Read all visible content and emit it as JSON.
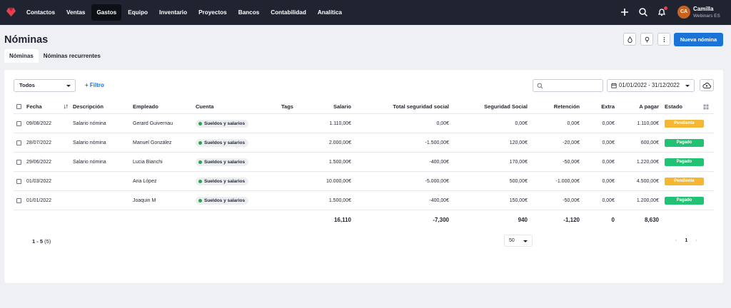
{
  "nav": {
    "items": [
      "Contactos",
      "Ventas",
      "Gastos",
      "Equipo",
      "Inventario",
      "Proyectos",
      "Bancos",
      "Contabilidad",
      "Analítica"
    ],
    "active": "Gastos"
  },
  "user": {
    "initials": "CA",
    "name": "Camilla",
    "org": "Webinars ES"
  },
  "page": {
    "title": "Nóminas",
    "new_button": "Nueva nómina"
  },
  "tabs": [
    {
      "label": "Nóminas",
      "active": true
    },
    {
      "label": "Nóminas recurrentes",
      "active": false
    }
  ],
  "toolbar": {
    "select_value": "Todos",
    "filter_label": "+ Filtro",
    "date_range": "01/01/2022 - 31/12/2022"
  },
  "table": {
    "headers": {
      "fecha": "Fecha",
      "descripcion": "Descripción",
      "empleado": "Empleado",
      "cuenta": "Cuenta",
      "tags": "Tags",
      "salario": "Salario",
      "total_ss": "Total seguridad social",
      "ss": "Seguridad Social",
      "retencion": "Retención",
      "extra": "Extra",
      "a_pagar": "A pagar",
      "estado": "Estado"
    },
    "rows": [
      {
        "fecha": "09/08/2022",
        "descripcion": "Salario nómina",
        "empleado": "Gerard Guivernau",
        "cuenta": "Sueldos y salarios",
        "salario": "1.110,00€",
        "total_ss": "0,00€",
        "ss": "0,00€",
        "retencion": "0,00€",
        "extra": "0,00€",
        "a_pagar": "1.110,00€",
        "estado": "Pendiente"
      },
      {
        "fecha": "28/07/2022",
        "descripcion": "Salario nómina",
        "empleado": "Manuel González",
        "cuenta": "Sueldos y salarios",
        "salario": "2.000,00€",
        "total_ss": "-1.500,00€",
        "ss": "120,00€",
        "retencion": "-20,00€",
        "extra": "0,00€",
        "a_pagar": "600,00€",
        "estado": "Pagado"
      },
      {
        "fecha": "29/06/2022",
        "descripcion": "Salario nómina",
        "empleado": "Lucia Bianchi",
        "cuenta": "Sueldos y salarios",
        "salario": "1.500,00€",
        "total_ss": "-400,00€",
        "ss": "170,00€",
        "retencion": "-50,00€",
        "extra": "0,00€",
        "a_pagar": "1.220,00€",
        "estado": "Pagado"
      },
      {
        "fecha": "01/03/2022",
        "descripcion": "",
        "empleado": "Ana López",
        "cuenta": "Sueldos y salarios",
        "salario": "10.000,00€",
        "total_ss": "-5.000,00€",
        "ss": "500,00€",
        "retencion": "-1.000,00€",
        "extra": "0,00€",
        "a_pagar": "4.500,00€",
        "estado": "Pendiente"
      },
      {
        "fecha": "01/01/2022",
        "descripcion": "",
        "empleado": "Joaquin M",
        "cuenta": "Sueldos y salarios",
        "salario": "1.500,00€",
        "total_ss": "-400,00€",
        "ss": "150,00€",
        "retencion": "-50,00€",
        "extra": "0,00€",
        "a_pagar": "1.200,00€",
        "estado": "Pagado"
      }
    ],
    "totals": {
      "salario": "16,110",
      "total_ss": "-7,300",
      "ss": "940",
      "retencion": "-1,120",
      "extra": "0",
      "a_pagar": "8,630"
    }
  },
  "pagination": {
    "range": "1 - 5",
    "count": "(5)",
    "per_page": "50",
    "current_page": "1",
    "prev": "‹",
    "next": "›"
  },
  "colors": {
    "topbar": "#1f2430",
    "primary": "#1a73d9",
    "pendiente": "#f5b731",
    "pagado": "#22c274",
    "account_dot": "#2ca24c",
    "notification": "#e5404f",
    "avatar": "#c9631f"
  },
  "icons": [
    "logo-icon",
    "plus-icon",
    "search-icon",
    "bell-icon",
    "drop-icon",
    "lightbulb-icon",
    "more-vertical-icon",
    "calendar-icon",
    "cloud-upload-icon",
    "sort-icon",
    "columns-icon",
    "chevron-down-icon"
  ]
}
